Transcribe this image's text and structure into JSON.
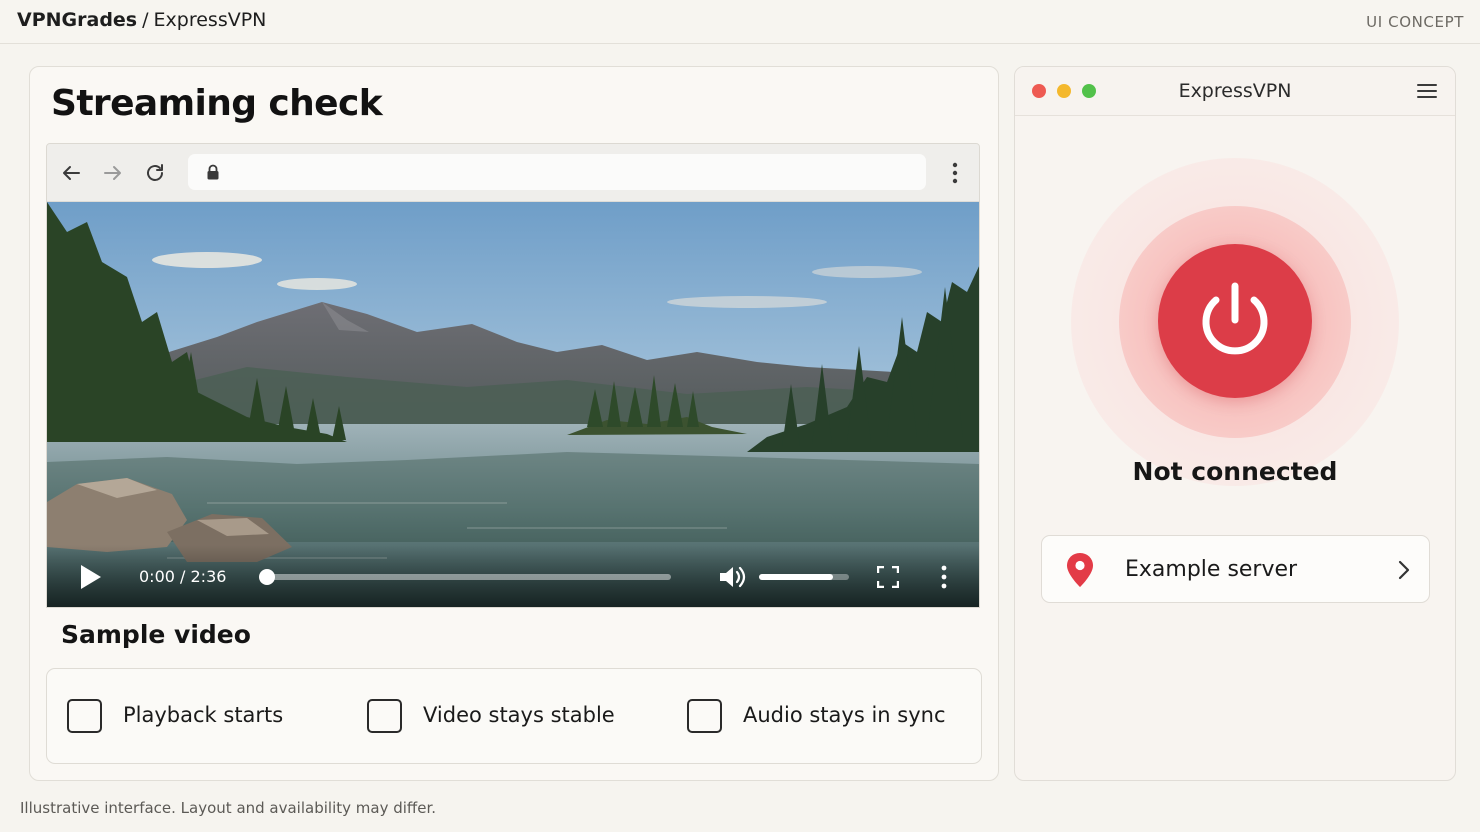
{
  "header": {
    "brand": "VPNGrades",
    "separator": "/",
    "product": "ExpressVPN",
    "tag": "UI CONCEPT"
  },
  "main": {
    "title": "Streaming check",
    "browser": {
      "icons": [
        "back-arrow-icon",
        "forward-arrow-icon",
        "reload-icon",
        "lock-icon",
        "more-vertical-icon"
      ],
      "url": ""
    },
    "video": {
      "time": "0:00 / 2:36",
      "progress": 0.0,
      "volume": 0.82,
      "icons": [
        "play-icon",
        "volume-icon",
        "fullscreen-icon",
        "more-vertical-icon"
      ]
    },
    "video_title": "Sample video",
    "checklist": [
      {
        "label": "Playback starts",
        "checked": false
      },
      {
        "label": "Video stays stable",
        "checked": false
      },
      {
        "label": "Audio stays in sync",
        "checked": false
      }
    ]
  },
  "vpn_app": {
    "title": "ExpressVPN",
    "status": "Not connected",
    "server": "Example server",
    "colors": {
      "power_button": "#dc3d48",
      "traffic_close": "#ee5a52",
      "traffic_min": "#f4b82d",
      "traffic_max": "#52c14a",
      "pin": "#e33b47"
    }
  },
  "footer": {
    "note": "Illustrative interface. Layout and availability may differ."
  }
}
